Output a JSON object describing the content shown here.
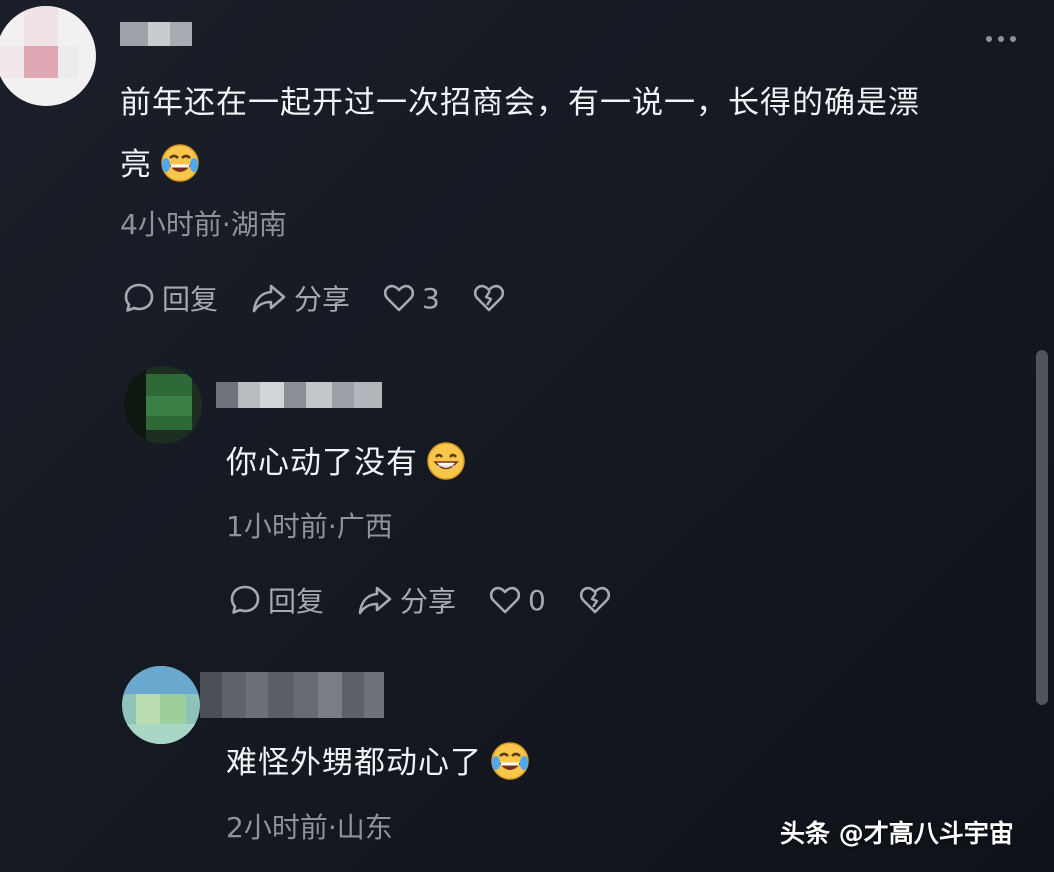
{
  "comments": [
    {
      "text_line1": "前年还在一起开过一次招商会，有一说一，长得的确是漂",
      "text_line2": "亮",
      "emoji": "laughing-tears-emoji",
      "meta": "4小时前·湖南",
      "reply_label": "回复",
      "share_label": "分享",
      "like_count": "3"
    },
    {
      "text": "你心动了没有",
      "emoji": "grinning-emoji",
      "meta": "1小时前·广西",
      "reply_label": "回复",
      "share_label": "分享",
      "like_count": "0"
    },
    {
      "text": "难怪外甥都动心了",
      "emoji": "laughing-tears-emoji",
      "meta": "2小时前·山东"
    }
  ],
  "watermark": "头条 @才高八斗宇宙",
  "colors": {
    "background": "#161a23",
    "text": "#f1f2f4",
    "meta": "#8d929b",
    "action": "#a5aab2"
  }
}
